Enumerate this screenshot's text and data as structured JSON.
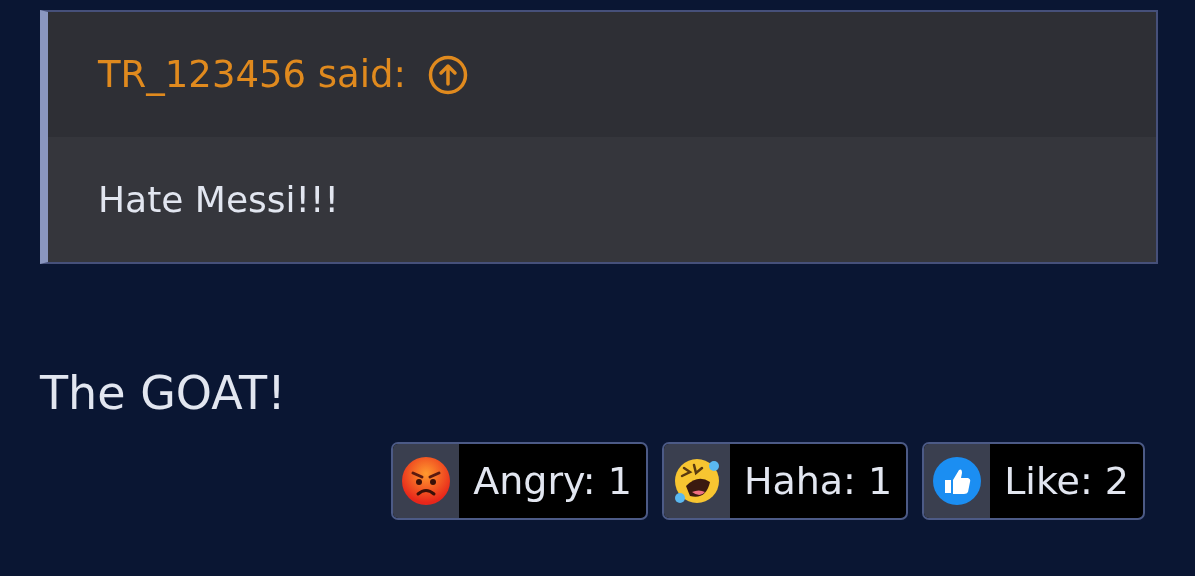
{
  "quote": {
    "author": "TR_123456 said:",
    "body": "Hate Messi!!!"
  },
  "post": {
    "text": "The GOAT!"
  },
  "reactions": [
    {
      "kind": "angry",
      "label": "Angry: 1"
    },
    {
      "kind": "haha",
      "label": "Haha: 1"
    },
    {
      "kind": "like",
      "label": "Like: 2"
    }
  ]
}
